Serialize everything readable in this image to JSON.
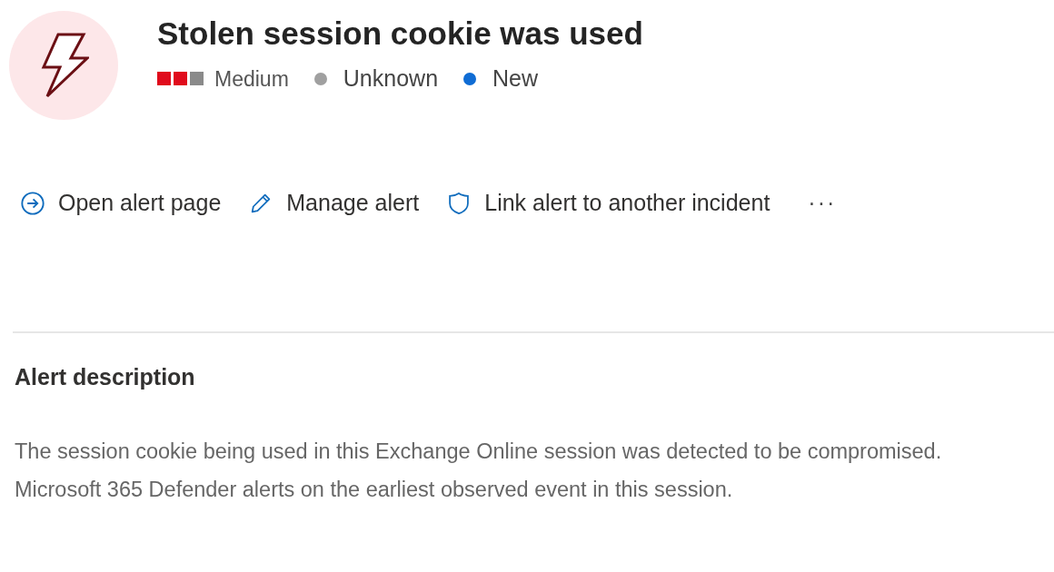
{
  "alert": {
    "title": "Stolen session cookie was used",
    "severity": {
      "squares": [
        {
          "filled": true
        },
        {
          "filled": true
        },
        {
          "filled": false
        }
      ],
      "label": "Medium"
    },
    "statuses": [
      {
        "label": "Unknown",
        "color": "#a0a0a0"
      },
      {
        "label": "New",
        "color": "#0f6cd4"
      }
    ]
  },
  "actions": [
    {
      "kind": "open",
      "label": "Open alert page"
    },
    {
      "kind": "edit",
      "label": "Manage alert"
    },
    {
      "kind": "link",
      "label": "Link alert to another incident"
    },
    {
      "kind": "more",
      "label": "···"
    }
  ],
  "description": {
    "heading": "Alert description",
    "text": "The session cookie being used in this Exchange Online session was detected to be compromised. Microsoft 365 Defender alerts on the earliest observed event in this session."
  }
}
